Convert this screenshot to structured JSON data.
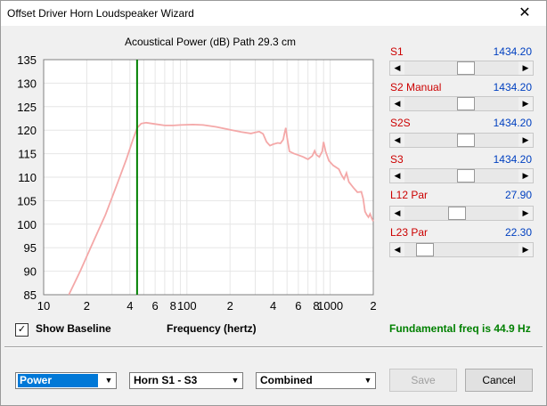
{
  "window": {
    "title": "Offset Driver Horn Loudspeaker Wizard",
    "close_glyph": "✕"
  },
  "chart_title": "Acoustical Power (dB)   Path 29.3 cm",
  "chart_data": {
    "type": "line",
    "xscale": "log",
    "xlim": [
      10,
      2000
    ],
    "ylim": [
      85,
      135
    ],
    "yticks": [
      85,
      90,
      95,
      100,
      105,
      110,
      115,
      120,
      125,
      130,
      135
    ],
    "xtick_labels": [
      {
        "v": 10,
        "t": "10"
      },
      {
        "v": 20,
        "t": "2"
      },
      {
        "v": 40,
        "t": "4"
      },
      {
        "v": 60,
        "t": "6"
      },
      {
        "v": 80,
        "t": "8"
      },
      {
        "v": 100,
        "t": "100"
      },
      {
        "v": 200,
        "t": "2"
      },
      {
        "v": 400,
        "t": "4"
      },
      {
        "v": 600,
        "t": "6"
      },
      {
        "v": 800,
        "t": "8"
      },
      {
        "v": 1000,
        "t": "1000"
      },
      {
        "v": 2000,
        "t": "2"
      }
    ],
    "xlabel": "Frequency (hertz)",
    "grid": true,
    "marker_x": 44.9,
    "series": [
      {
        "color": "#f4a8a8",
        "points": [
          [
            15,
            85
          ],
          [
            18,
            90
          ],
          [
            22,
            96
          ],
          [
            27,
            102
          ],
          [
            33,
            109
          ],
          [
            38,
            114
          ],
          [
            42,
            118
          ],
          [
            45,
            120.5
          ],
          [
            48,
            121.4
          ],
          [
            52,
            121.6
          ],
          [
            60,
            121.3
          ],
          [
            70,
            121
          ],
          [
            80,
            121
          ],
          [
            90,
            121.1
          ],
          [
            110,
            121.2
          ],
          [
            130,
            121.1
          ],
          [
            160,
            120.7
          ],
          [
            200,
            120.1
          ],
          [
            240,
            119.6
          ],
          [
            280,
            119.3
          ],
          [
            300,
            119.5
          ],
          [
            320,
            119.7
          ],
          [
            340,
            119.2
          ],
          [
            360,
            117.5
          ],
          [
            380,
            116.7
          ],
          [
            400,
            117
          ],
          [
            430,
            117.3
          ],
          [
            450,
            117.2
          ],
          [
            470,
            118
          ],
          [
            480,
            119.3
          ],
          [
            490,
            120.5
          ],
          [
            500,
            118.5
          ],
          [
            520,
            115.5
          ],
          [
            560,
            115
          ],
          [
            600,
            114.7
          ],
          [
            650,
            114.3
          ],
          [
            700,
            113.8
          ],
          [
            750,
            114.5
          ],
          [
            780,
            115.6
          ],
          [
            800,
            114.8
          ],
          [
            840,
            114.3
          ],
          [
            880,
            115.5
          ],
          [
            900,
            117.5
          ],
          [
            930,
            115.5
          ],
          [
            980,
            113.5
          ],
          [
            1050,
            112.5
          ],
          [
            1150,
            111.7
          ],
          [
            1200,
            110.5
          ],
          [
            1250,
            109.6
          ],
          [
            1300,
            110.9
          ],
          [
            1350,
            109
          ],
          [
            1450,
            107.8
          ],
          [
            1550,
            106.8
          ],
          [
            1650,
            106.9
          ],
          [
            1700,
            105.4
          ],
          [
            1750,
            102.7
          ],
          [
            1800,
            102
          ],
          [
            1850,
            101.5
          ],
          [
            1900,
            102.2
          ],
          [
            1950,
            101.3
          ],
          [
            2000,
            100.6
          ]
        ]
      }
    ]
  },
  "show_baseline": {
    "checked": true,
    "mark": "✓",
    "label": "Show Baseline"
  },
  "fundamental": "Fundamental freq is 44.9 Hz",
  "controls": [
    {
      "label": "S1",
      "value": "1434.20",
      "level": 0.55
    },
    {
      "label": "S2  Manual",
      "value": "1434.20",
      "level": 0.55
    },
    {
      "label": "S2S",
      "value": "1434.20",
      "level": 0.55
    },
    {
      "label": "S3",
      "value": "1434.20",
      "level": 0.55
    },
    {
      "label": "L12  Par",
      "value": "27.90",
      "level": 0.45
    },
    {
      "label": "L23  Par",
      "value": "22.30",
      "level": 0.12
    }
  ],
  "arrows": {
    "left": "◀",
    "right": "▶",
    "down": "▼"
  },
  "dropdowns": {
    "mode": "Power",
    "horn": "Horn S1 - S3",
    "combine": "Combined"
  },
  "buttons": {
    "save": "Save",
    "cancel": "Cancel"
  }
}
